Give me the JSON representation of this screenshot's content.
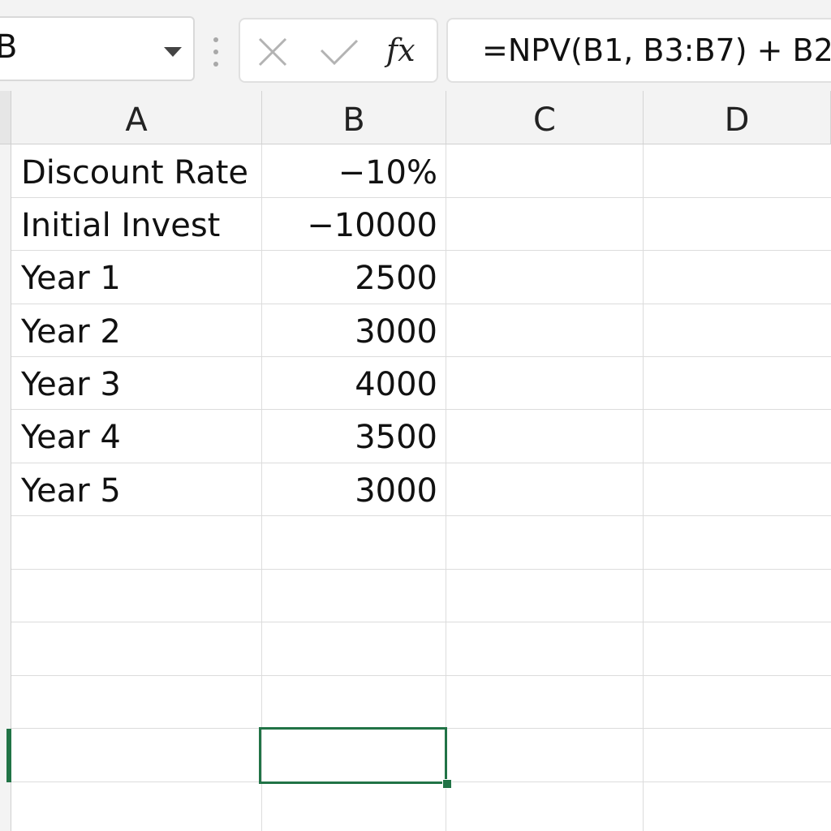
{
  "formula_bar": {
    "name_box_value": "B",
    "function_label": "fx",
    "formula": "=NPV(B1, B3:B7) + B2"
  },
  "columns": [
    "A",
    "B",
    "C",
    "D"
  ],
  "rows": [
    {
      "a": "Discount Rate",
      "b": "−10%"
    },
    {
      "a": "Initial Invest",
      "b": "−10000"
    },
    {
      "a": "Year 1",
      "b": "2500"
    },
    {
      "a": "Year 2",
      "b": "3000"
    },
    {
      "a": "Year 3",
      "b": "4000"
    },
    {
      "a": "Year 4",
      "b": "3500"
    },
    {
      "a": "Year 5",
      "b": "3000"
    }
  ],
  "colors": {
    "selection": "#217346",
    "header_bg": "#f3f3f3",
    "gridline": "#dcdcdc"
  },
  "icons": {
    "cancel": "x-icon",
    "enter": "checkmark-icon",
    "insert_function": "fx-icon",
    "name_box_dropdown": "caret-down-icon"
  }
}
